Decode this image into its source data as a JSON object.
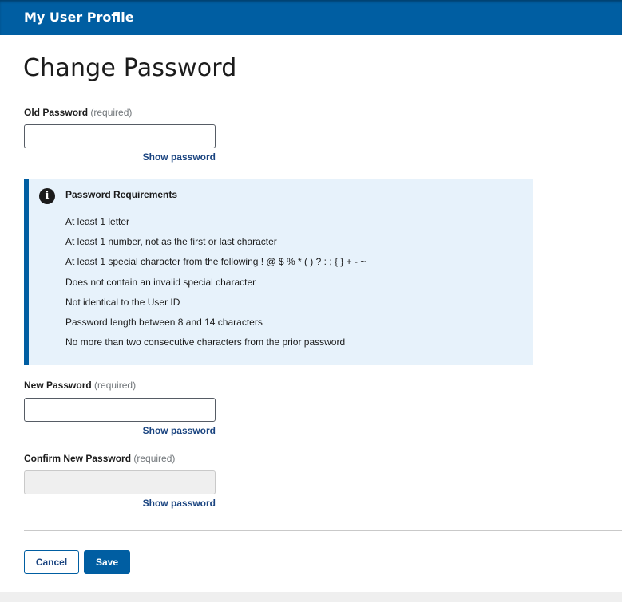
{
  "header": {
    "title": "My User Profile"
  },
  "page": {
    "title": "Change Password"
  },
  "fields": {
    "old_password": {
      "label": "Old Password",
      "required_hint": "(required)",
      "value": "",
      "show_label": "Show password"
    },
    "new_password": {
      "label": "New Password",
      "required_hint": "(required)",
      "value": "",
      "show_label": "Show password"
    },
    "confirm_password": {
      "label": "Confirm New Password",
      "required_hint": "(required)",
      "value": "",
      "disabled": true,
      "show_label": "Show password"
    }
  },
  "requirements": {
    "icon": "info-icon",
    "icon_glyph": "i",
    "title": "Password Requirements",
    "items": [
      "At least 1 letter",
      "At least 1 number, not as the first or last character",
      "At least 1 special character from the following ! @ $ % * ( ) ? : ; { } + - ~",
      "Does not contain an invalid special character",
      "Not identical to the User ID",
      "Password length between 8 and 14 characters",
      "No more than two consecutive characters from the prior password"
    ]
  },
  "actions": {
    "cancel_label": "Cancel",
    "save_label": "Save"
  },
  "colors": {
    "primary": "#005ea2",
    "link": "#1a4480",
    "info_bg": "#e7f2fb"
  }
}
